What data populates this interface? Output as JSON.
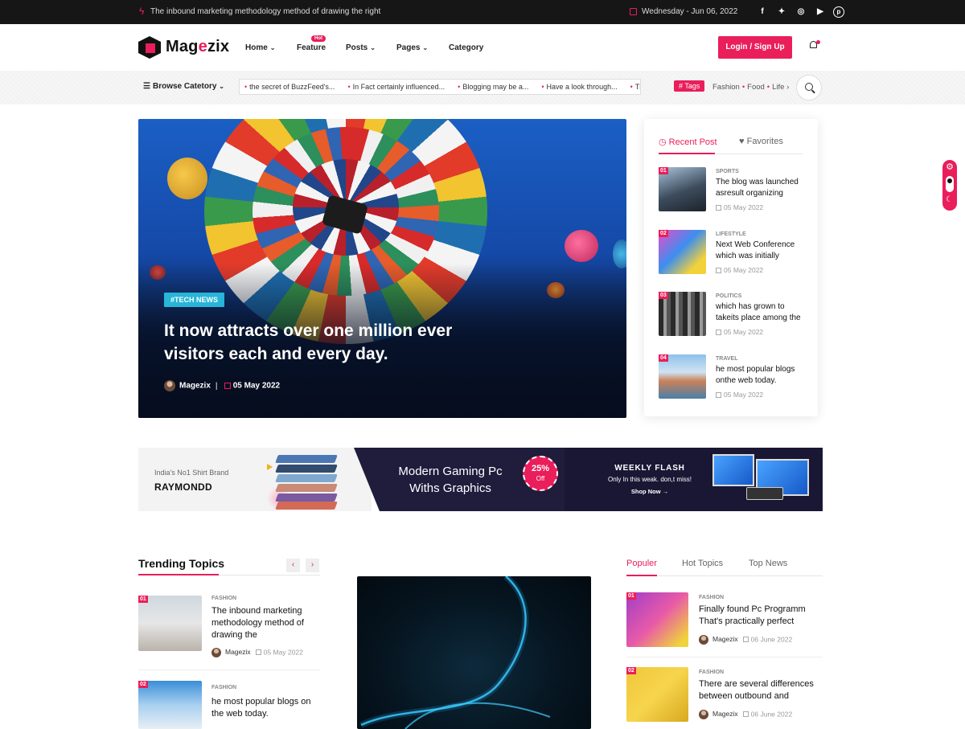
{
  "topbar": {
    "message": "The inbound marketing methodology method of drawing the right",
    "date": "Wednesday - Jun 06, 2022",
    "social": [
      "f",
      "t",
      "ig",
      "yt",
      "p"
    ]
  },
  "header": {
    "logo_pre": "Mag",
    "logo_accent": "e",
    "logo_post": "zix",
    "nav": [
      {
        "label": "Home",
        "dropdown": true
      },
      {
        "label": "Feature",
        "dropdown": false,
        "badge": "Hot"
      },
      {
        "label": "Posts",
        "dropdown": true
      },
      {
        "label": "Pages",
        "dropdown": true
      },
      {
        "label": "Category",
        "dropdown": false
      }
    ],
    "login_label": "Login / Sign Up"
  },
  "subbar": {
    "browse_label": "Browse Catetory",
    "ticker": [
      "the secret of BuzzFeed's...",
      "In Fact certainly influenced...",
      "Blogging may be a...",
      "Have a look through...",
      "Th"
    ],
    "tags_label": "# Tags",
    "tags": [
      "Fashion",
      "Food",
      "Life"
    ]
  },
  "hero": {
    "tag": "#TECH NEWS",
    "title": "It now attracts over one million ever visitors each and every day.",
    "author": "Magezix",
    "date": "05 May 2022"
  },
  "sidebar": {
    "tabs": [
      "Recent Post",
      "Favorites"
    ],
    "posts": [
      {
        "num": "01",
        "category": "SPORTS",
        "title": "The blog was launched asresult organizing",
        "date": "05 May 2022"
      },
      {
        "num": "02",
        "category": "LIFESTYLE",
        "title": "Next Web Conference which was initially",
        "date": "05 May 2022"
      },
      {
        "num": "03",
        "category": "POLITICS",
        "title": "which has grown to takeits place among the",
        "date": "05 May 2022"
      },
      {
        "num": "04",
        "category": "TRAVEL",
        "title": "he most popular blogs onthe web today.",
        "date": "05 May 2022"
      }
    ]
  },
  "banner": {
    "sub": "India's No1 Shirt Brand",
    "brand": "RAYMONDD",
    "game_line1": "Modern Gaming Pc",
    "game_line2": "Withs Graphics",
    "badge_pct": "25%",
    "badge_off": "Off",
    "weekly": "WEEKLY FLASH",
    "weekly_sub": "Only In this weak. don,t miss!",
    "shop": "Shop Now →"
  },
  "trending": {
    "title": "Trending Topics",
    "items": [
      {
        "num": "01",
        "category": "FASHION",
        "title": "The inbound marketing methodology method of drawing the",
        "author": "Magezix",
        "date": "05 May 2022"
      },
      {
        "num": "02",
        "category": "FASHION",
        "title": "he most popular blogs on the web today.",
        "author": "",
        "date": ""
      }
    ]
  },
  "popular": {
    "tabs": [
      "Populer",
      "Hot Topics",
      "Top News"
    ],
    "items": [
      {
        "num": "01",
        "category": "FASHION",
        "title": "Finally found Pc Programm That's practically perfect",
        "author": "Magezix",
        "date": "06 June 2022"
      },
      {
        "num": "02",
        "category": "FASHION",
        "title": "There are several differences between outbound and",
        "author": "Magezix",
        "date": "06 June 2022"
      }
    ]
  },
  "colors": {
    "accent": "#e91e5a",
    "dark": "#161616",
    "tech_tag": "#27b5d8"
  }
}
